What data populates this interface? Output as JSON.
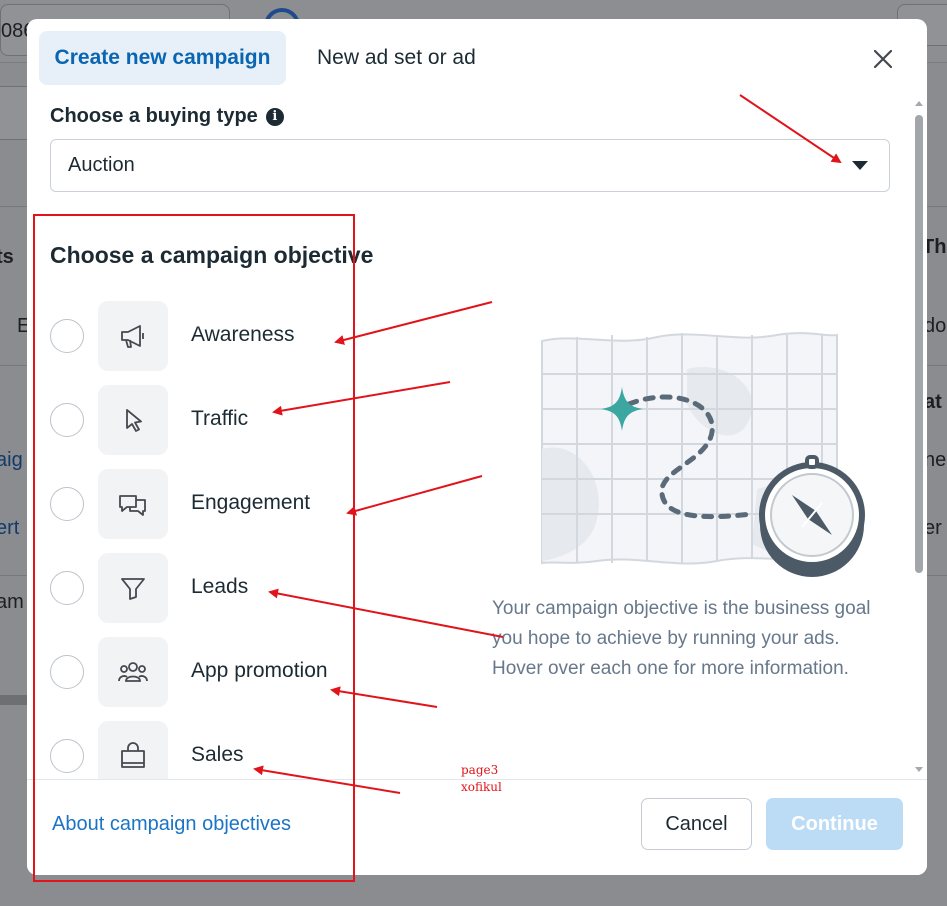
{
  "background": {
    "top_field_text": "086",
    "left_cut_texts": [
      "ts",
      "E",
      "aig",
      "ert",
      "am"
    ],
    "right_cut_texts": [
      "Th",
      "do",
      "at",
      "nes",
      "er"
    ]
  },
  "tabs": {
    "create_label": "Create new campaign",
    "adset_label": "New ad set or ad"
  },
  "buying_type": {
    "label": "Choose a buying type",
    "info_glyph": "i",
    "value": "Auction"
  },
  "objective": {
    "title": "Choose a campaign objective",
    "options": [
      {
        "label": "Awareness",
        "icon": "megaphone-icon"
      },
      {
        "label": "Traffic",
        "icon": "cursor-icon"
      },
      {
        "label": "Engagement",
        "icon": "chat-bubbles-icon"
      },
      {
        "label": "Leads",
        "icon": "filter-icon"
      },
      {
        "label": "App promotion",
        "icon": "people-icon"
      },
      {
        "label": "Sales",
        "icon": "shopping-bag-icon"
      }
    ],
    "description": "Your campaign objective is the business goal you hope to achieve by running your ads. Hover over each one for more information."
  },
  "footer": {
    "about_link": "About campaign objectives",
    "cancel_label": "Cancel",
    "continue_label": "Continue"
  },
  "annotation": {
    "note_line1": "page3",
    "note_line2": "xofikul",
    "color": "#e0141a"
  },
  "colors": {
    "accent": "#0a66b2",
    "link": "#1b74c5",
    "continue_disabled": "#bcdcf5",
    "illustration_teal": "#3ba7a0"
  }
}
